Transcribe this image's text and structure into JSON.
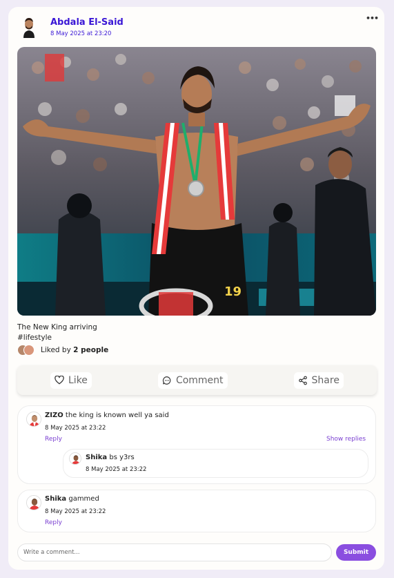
{
  "post": {
    "author_name": "Abdala El-Said",
    "timestamp": "8 May 2025 at 23:20",
    "more_icon": "ellipsis-icon",
    "caption": "The New King arriving",
    "hashtag": "#lifestyle",
    "liked_prefix": "Liked by",
    "liked_count": "2 people"
  },
  "actions": {
    "like": {
      "label": "Like",
      "icon": "heart-icon"
    },
    "comment": {
      "label": "Comment",
      "icon": "chat-bubble-icon"
    },
    "share": {
      "label": "Share",
      "icon": "share-icon"
    }
  },
  "comments": [
    {
      "user": "ZIZO",
      "text": "the king is known well ya said",
      "time": "8 May 2025 at 23:22",
      "reply_label": "Reply",
      "show_replies_label": "Show replies",
      "replies": [
        {
          "user": "Shika",
          "text": "bs y3rs",
          "time": "8 May 2025 at 23:22"
        }
      ]
    },
    {
      "user": "Shika",
      "text": "gammed",
      "time": "8 May 2025 at 23:22",
      "reply_label": "Reply"
    }
  ],
  "composer": {
    "placeholder": "Write a comment...",
    "submit_label": "Submit"
  },
  "colors": {
    "accent": "#8a4ee0",
    "author_link": "#3a17d6",
    "page_background": "#f0ecf7"
  }
}
